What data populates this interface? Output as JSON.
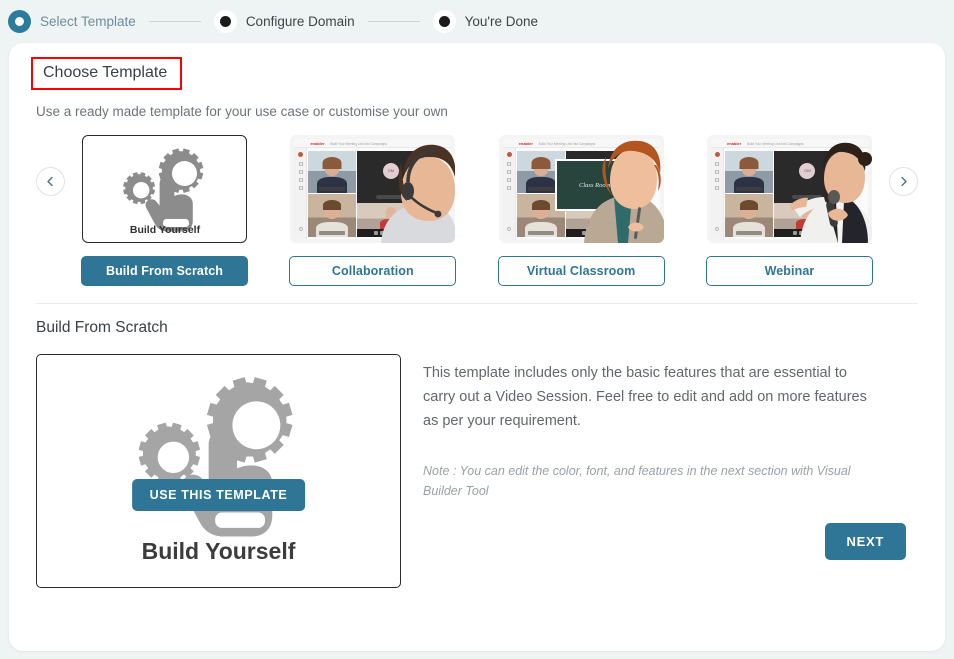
{
  "stepper": {
    "steps": [
      {
        "label": "Select Template",
        "state": "active"
      },
      {
        "label": "Configure Domain",
        "state": "pending"
      },
      {
        "label": "You're Done",
        "state": "pending"
      }
    ]
  },
  "header": {
    "title": "Choose Template",
    "subtitle": "Use a ready made template for your use case or customise your own"
  },
  "carousel": {
    "prev_icon": "chevron-left-icon",
    "next_icon": "chevron-right-icon",
    "templates": [
      {
        "button_label": "Build From Scratch",
        "thumb_caption": "Build Yourself",
        "thumb_type": "illustration",
        "selected": true
      },
      {
        "button_label": "Collaboration",
        "thumb_caption": "",
        "thumb_type": "screenshot-headset",
        "selected": false
      },
      {
        "button_label": "Virtual Classroom",
        "thumb_caption": "",
        "thumb_type": "screenshot-classroom",
        "selected": false
      },
      {
        "button_label": "Webinar",
        "thumb_caption": "",
        "thumb_type": "screenshot-webinar",
        "selected": false
      }
    ]
  },
  "detail": {
    "section_title": "Build From Scratch",
    "use_template_label": "USE THIS TEMPLATE",
    "preview_caption": "Build Yourself",
    "description": "This template includes only the basic features that are essential to carry out a Video Session. Feel free to edit and add on more features as per your requirement.",
    "note": "Note : You can edit the color, font, and features in the next section with Visual Builder Tool",
    "next_label": "NEXT"
  },
  "mock_labels": {
    "logo": "enabler",
    "top_text": "Build Your Meeting Link Into Campaigns",
    "board_text": "Class Room",
    "avatar_initials": "GM"
  },
  "colors": {
    "accent": "#2e7596",
    "stepper_active": "#2c7a9c",
    "highlight_border": "#ff0000",
    "page_background": "#eef4f4",
    "card_background": "#ffffff"
  }
}
